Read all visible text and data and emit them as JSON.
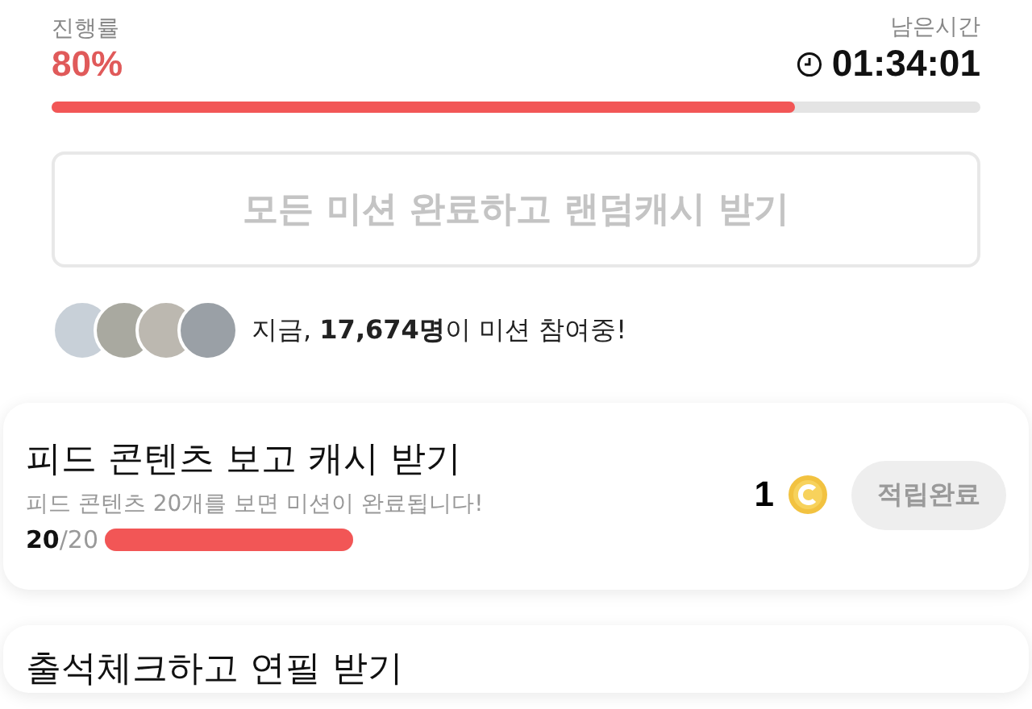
{
  "progress": {
    "label": "진행률",
    "value": "80%",
    "level": 0.8
  },
  "time": {
    "label": "남은시간",
    "value": "01:34:01"
  },
  "bonus_button": {
    "label": "모든 미션 완료하고 랜덤캐시 받기",
    "disabled": true
  },
  "participants": {
    "text": "지금, **17,674명**이 미션 참여중!"
  },
  "missions": [
    {
      "title": "피드 콘텐츠 보고 캐시 받기",
      "description": "피드 콘텐츠 20개를 보면 미션이 완료됩니다!",
      "done": "20",
      "total": "/20",
      "level": 1,
      "reward": "1",
      "button": "적립완료",
      "disabled": true
    },
    {
      "title": "출석체크하고 연필 받기"
    }
  ]
}
